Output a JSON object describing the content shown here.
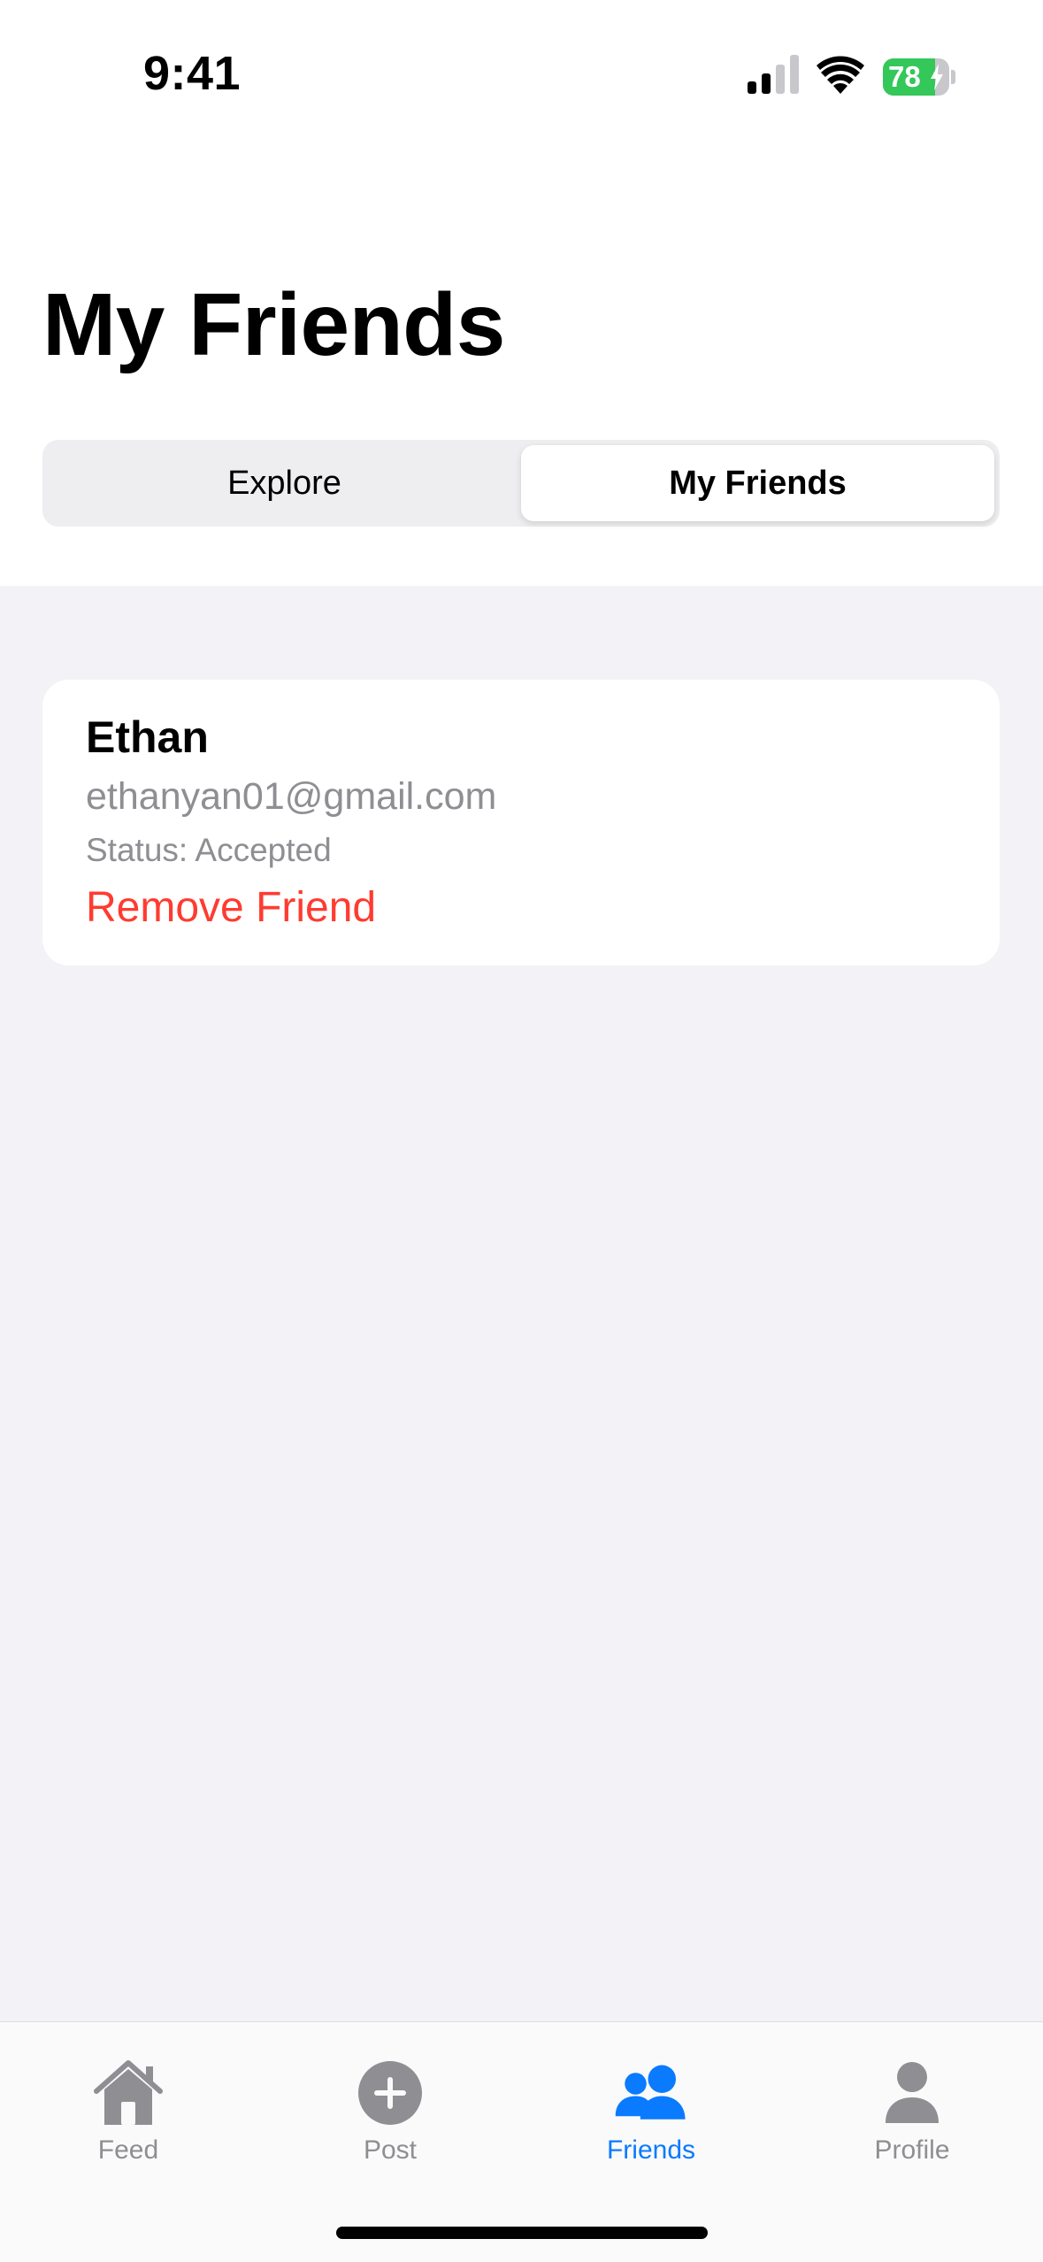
{
  "status_bar": {
    "time": "9:41",
    "battery_percent": "78",
    "battery_level": 0.78,
    "battery_color": "#34c759"
  },
  "header": {
    "title": "My Friends",
    "segments": [
      {
        "label": "Explore",
        "selected": false
      },
      {
        "label": "My Friends",
        "selected": true
      }
    ]
  },
  "friends": [
    {
      "name": "Ethan",
      "email": "ethanyan01@gmail.com",
      "status": "Status: Accepted",
      "action_label": "Remove Friend",
      "action_color": "#ff3b30"
    }
  ],
  "tab_bar": {
    "active_color": "#0a7aff",
    "inactive_color": "#8e8e93",
    "tabs": [
      {
        "label": "Feed",
        "icon": "house-icon",
        "active": false
      },
      {
        "label": "Post",
        "icon": "plus-circle-icon",
        "active": false
      },
      {
        "label": "Friends",
        "icon": "people-icon",
        "active": true
      },
      {
        "label": "Profile",
        "icon": "person-icon",
        "active": false
      }
    ]
  }
}
